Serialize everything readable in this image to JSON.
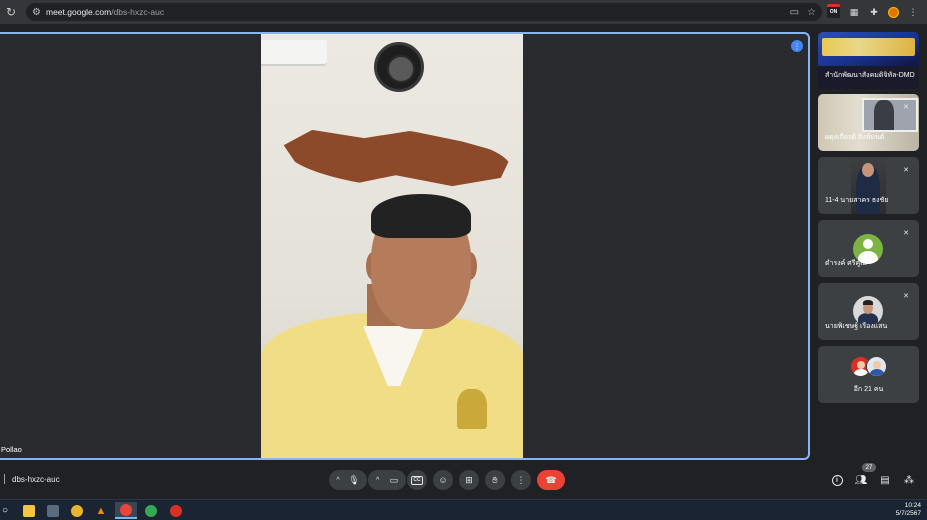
{
  "browser": {
    "url_host": "meet.google.com",
    "url_path": "/dbs-hxzc-auc",
    "extension_on_label": "ON"
  },
  "stage": {
    "participant_name": "Pollao"
  },
  "tiles": [
    {
      "name": "สำนักพัฒนาสังคมดิจิทัล-DMD",
      "muted": false
    },
    {
      "name": "ผดุงเกียรติ สิงห์มนต์",
      "muted": true
    },
    {
      "name": "11-4 นายสาคร ธงชัย",
      "muted": true
    },
    {
      "name": "ดำรงค์ ศรีคูณ",
      "muted": true
    },
    {
      "name": "นายพิเชษฐ์ เรืองแสน",
      "muted": true
    },
    {
      "name": "อีก 21 คน",
      "muted": false
    }
  ],
  "meeting": {
    "code": "dbs-hxzc-auc",
    "participant_count": "27",
    "cc_label": "CC"
  },
  "taskbar": {
    "time": "10:24",
    "date": "5/7/2567"
  },
  "colors": {
    "accent": "#8ab4f8",
    "end_call": "#ea4335",
    "control_bg": "#3c4043",
    "background": "#202124"
  }
}
